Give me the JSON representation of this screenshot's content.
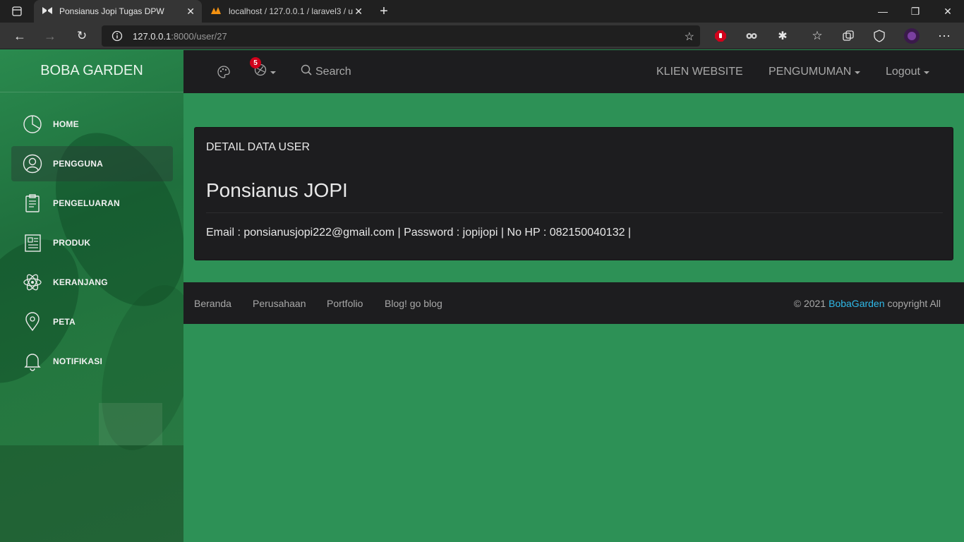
{
  "browser": {
    "tabs": [
      {
        "title": "Ponsianus Jopi Tugas DPW",
        "active": true
      },
      {
        "title": "localhost / 127.0.0.1 / laravel3 / u",
        "active": false
      }
    ],
    "url_host": "127.0.0.1",
    "url_rest": ":8000/user/27"
  },
  "sidebar": {
    "brand": "BOBA GARDEN",
    "items": [
      {
        "label": "HOME",
        "icon": "pie-chart-icon"
      },
      {
        "label": "PENGGUNA",
        "icon": "user-icon",
        "active": true
      },
      {
        "label": "PENGELUARAN",
        "icon": "clipboard-icon"
      },
      {
        "label": "PRODUK",
        "icon": "newspaper-icon"
      },
      {
        "label": "KERANJANG",
        "icon": "atom-icon"
      },
      {
        "label": "PETA",
        "icon": "map-pin-icon"
      },
      {
        "label": "NOTIFIKASI",
        "icon": "bell-icon"
      }
    ]
  },
  "topnav": {
    "notification_count": "5",
    "search_label": "Search",
    "klien_label": "KLIEN WEBSITE",
    "pengumuman_label": "PENGUMUMAN",
    "logout_label": "Logout"
  },
  "card": {
    "title": "DETAIL DATA USER",
    "name": "Ponsianus JOPI",
    "info": "Email : ponsianusjopi222@gmail.com | Password : jopijopi | No HP : 082150040132 |"
  },
  "footer": {
    "links": [
      "Beranda",
      "Perusahaan",
      "Portfolio",
      "Blog! go blog"
    ],
    "copy_prefix": "© 2021",
    "copy_brand": "BobaGarden",
    "copy_suffix": "copyright All"
  },
  "colors": {
    "page_bg": "#2d9156",
    "dark_panel": "#1d1d1f",
    "badge": "#d0021b",
    "link": "#2fb9e8"
  }
}
